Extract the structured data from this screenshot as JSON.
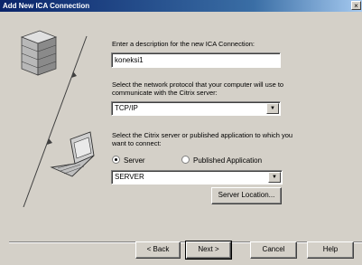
{
  "window": {
    "title": "Add New ICA Connection",
    "close_glyph": "×"
  },
  "description": {
    "label": "Enter a description for the new ICA Connection:",
    "value": "koneksi1"
  },
  "protocol": {
    "label_line1": "Select the network protocol that your computer will use to",
    "label_line2": "communicate with the Citrix server:",
    "selected": "TCP/IP"
  },
  "target": {
    "label_line1": "Select the Citrix server or published application to which you",
    "label_line2": "want to connect:",
    "option_server": "Server",
    "option_published": "Published Application",
    "selected_option": "Server",
    "server_value": "SERVER",
    "server_location_button": "Server Location..."
  },
  "footer": {
    "back_button": "< Back",
    "next_button": "Next >",
    "cancel_button": "Cancel",
    "help_button": "Help"
  },
  "icons": [
    "server-stack-icon",
    "laptop-icon",
    "connection-line-icon",
    "dropdown-arrow-icon"
  ]
}
